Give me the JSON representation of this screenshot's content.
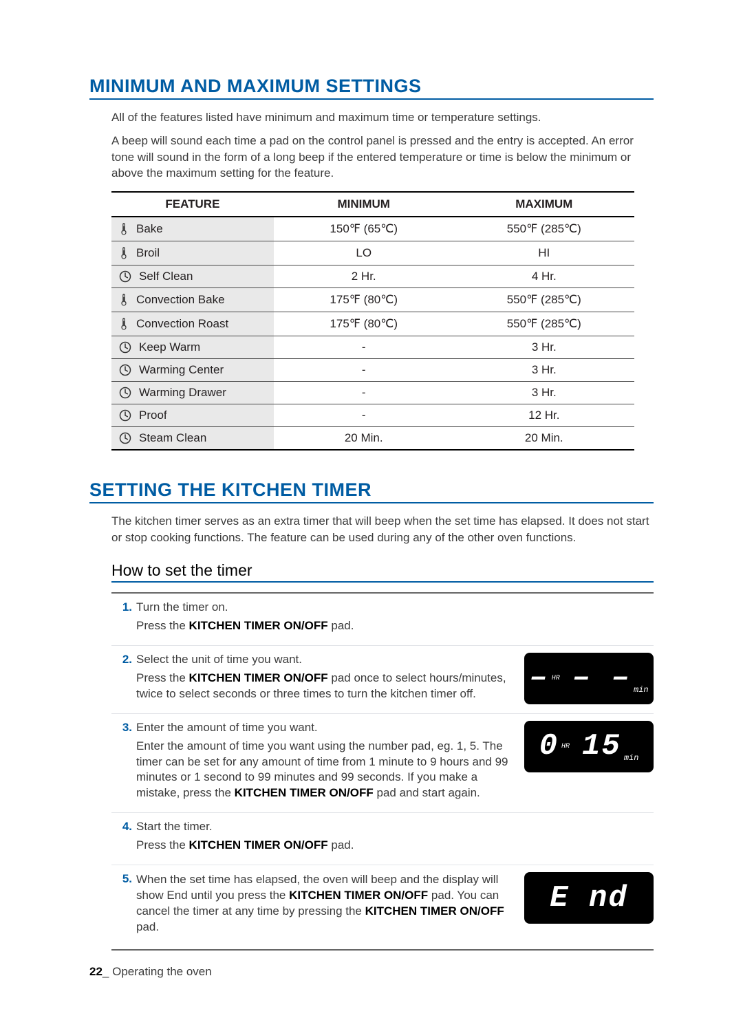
{
  "headings": {
    "minmax": "MINIMUM AND MAXIMUM SETTINGS",
    "kitchen_timer": "SETTING THE KITCHEN TIMER",
    "how_to_set": "How to set the timer"
  },
  "intro": {
    "p1": "All of the features listed have minimum and maximum time or temperature settings.",
    "p2": "A beep will sound each time a pad on the control panel is pressed and the entry is accepted. An error tone will sound in the form of a long beep if the entered temperature or time is below the minimum or above the maximum setting for the feature."
  },
  "table": {
    "headers": {
      "feature": "FEATURE",
      "min": "MINIMUM",
      "max": "MAXIMUM"
    },
    "rows": [
      {
        "icon": "therm",
        "feature": "Bake",
        "min": "150℉ (65℃)",
        "max": "550℉ (285℃)"
      },
      {
        "icon": "therm",
        "feature": "Broil",
        "min": "LO",
        "max": "HI"
      },
      {
        "icon": "clock",
        "feature": "Self Clean",
        "min": "2 Hr.",
        "max": "4 Hr."
      },
      {
        "icon": "therm",
        "feature": "Convection Bake",
        "min": "175℉ (80℃)",
        "max": "550℉ (285℃)"
      },
      {
        "icon": "therm",
        "feature": "Convection Roast",
        "min": "175℉ (80℃)",
        "max": "550℉ (285℃)"
      },
      {
        "icon": "clock",
        "feature": "Keep Warm",
        "min": "-",
        "max": "3 Hr."
      },
      {
        "icon": "clock",
        "feature": "Warming Center",
        "min": "-",
        "max": "3 Hr."
      },
      {
        "icon": "clock",
        "feature": "Warming Drawer",
        "min": "-",
        "max": "3 Hr."
      },
      {
        "icon": "clock",
        "feature": "Proof",
        "min": "-",
        "max": "12 Hr."
      },
      {
        "icon": "clock",
        "feature": "Steam Clean",
        "min": "20 Min.",
        "max": "20 Min."
      }
    ]
  },
  "timer_intro": "The kitchen timer serves as an extra timer that will beep when the set time has elapsed. It does not start or stop cooking functions. The feature can be used during any of the other oven functions.",
  "steps": [
    {
      "num": "1",
      "title": "Turn the timer on.",
      "detail_parts": [
        "Press the ",
        "KITCHEN TIMER ON/OFF",
        " pad."
      ],
      "panel": null
    },
    {
      "num": "2",
      "title": "Select the unit of time you want.",
      "detail_parts": [
        "Press the ",
        "KITCHEN TIMER ON/OFF",
        " pad once to select hours/minutes, twice to select seconds or three times to turn the kitchen timer off."
      ],
      "panel": {
        "hr": "–",
        "hr_label": "HR",
        "min": "– –",
        "min_label": "min"
      }
    },
    {
      "num": "3",
      "title": "Enter the amount of time you want.",
      "detail_parts": [
        "Enter the amount of time you want using the number pad, eg. 1, 5. The timer can be set for any amount of time from 1 minute to 9 hours and 99 minutes or 1 second to 99 minutes and 99 seconds. If you make a mistake, press the ",
        "KITCHEN TIMER ON/OFF",
        " pad and start again."
      ],
      "panel": {
        "hr": "0",
        "hr_label": "HR",
        "min": "15",
        "min_label": "min"
      }
    },
    {
      "num": "4",
      "title": "Start the timer.",
      "detail_parts": [
        "Press the ",
        "KITCHEN TIMER ON/OFF",
        " pad."
      ],
      "panel": null
    },
    {
      "num": "5",
      "title": "",
      "detail_parts": [
        "When the set time has elapsed, the oven will beep and the display will show End until you press the ",
        "KITCHEN TIMER ON/OFF",
        " pad. You can cancel the timer at any time by pressing the ",
        "KITCHEN TIMER ON/OFF",
        " pad."
      ],
      "panel": {
        "end": "E nd"
      }
    }
  ],
  "footer": {
    "page": "22",
    "sep": "_",
    "label": " Operating the oven"
  }
}
